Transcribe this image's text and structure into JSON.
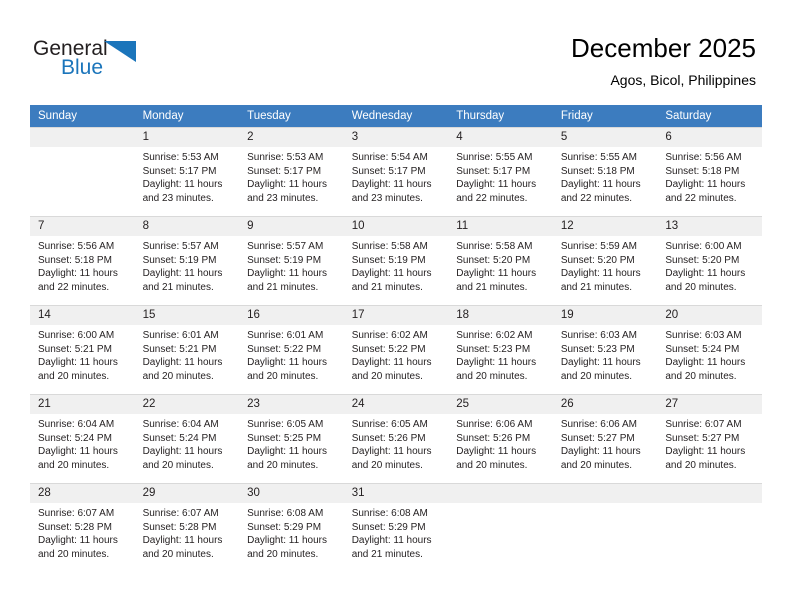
{
  "logo": {
    "word1": "General",
    "word2": "Blue",
    "icon": "triangle-logo-icon",
    "accent_color": "#1b75bb"
  },
  "header": {
    "title": "December 2025",
    "subtitle": "Agos, Bicol, Philippines"
  },
  "theme": {
    "header_row_bg": "#3c7cbf",
    "daynum_bg": "#f0f0f0",
    "grid_line": "#d9d9d9",
    "text": "#231f20"
  },
  "columns": [
    "Sunday",
    "Monday",
    "Tuesday",
    "Wednesday",
    "Thursday",
    "Friday",
    "Saturday"
  ],
  "weeks": [
    [
      {
        "day": "",
        "blank": true,
        "sunrise": "",
        "sunset": "",
        "daylight1": "",
        "daylight2": ""
      },
      {
        "day": "1",
        "sunrise": "Sunrise: 5:53 AM",
        "sunset": "Sunset: 5:17 PM",
        "daylight1": "Daylight: 11 hours",
        "daylight2": "and 23 minutes."
      },
      {
        "day": "2",
        "sunrise": "Sunrise: 5:53 AM",
        "sunset": "Sunset: 5:17 PM",
        "daylight1": "Daylight: 11 hours",
        "daylight2": "and 23 minutes."
      },
      {
        "day": "3",
        "sunrise": "Sunrise: 5:54 AM",
        "sunset": "Sunset: 5:17 PM",
        "daylight1": "Daylight: 11 hours",
        "daylight2": "and 23 minutes."
      },
      {
        "day": "4",
        "sunrise": "Sunrise: 5:55 AM",
        "sunset": "Sunset: 5:17 PM",
        "daylight1": "Daylight: 11 hours",
        "daylight2": "and 22 minutes."
      },
      {
        "day": "5",
        "sunrise": "Sunrise: 5:55 AM",
        "sunset": "Sunset: 5:18 PM",
        "daylight1": "Daylight: 11 hours",
        "daylight2": "and 22 minutes."
      },
      {
        "day": "6",
        "sunrise": "Sunrise: 5:56 AM",
        "sunset": "Sunset: 5:18 PM",
        "daylight1": "Daylight: 11 hours",
        "daylight2": "and 22 minutes."
      }
    ],
    [
      {
        "day": "7",
        "sunrise": "Sunrise: 5:56 AM",
        "sunset": "Sunset: 5:18 PM",
        "daylight1": "Daylight: 11 hours",
        "daylight2": "and 22 minutes."
      },
      {
        "day": "8",
        "sunrise": "Sunrise: 5:57 AM",
        "sunset": "Sunset: 5:19 PM",
        "daylight1": "Daylight: 11 hours",
        "daylight2": "and 21 minutes."
      },
      {
        "day": "9",
        "sunrise": "Sunrise: 5:57 AM",
        "sunset": "Sunset: 5:19 PM",
        "daylight1": "Daylight: 11 hours",
        "daylight2": "and 21 minutes."
      },
      {
        "day": "10",
        "sunrise": "Sunrise: 5:58 AM",
        "sunset": "Sunset: 5:19 PM",
        "daylight1": "Daylight: 11 hours",
        "daylight2": "and 21 minutes."
      },
      {
        "day": "11",
        "sunrise": "Sunrise: 5:58 AM",
        "sunset": "Sunset: 5:20 PM",
        "daylight1": "Daylight: 11 hours",
        "daylight2": "and 21 minutes."
      },
      {
        "day": "12",
        "sunrise": "Sunrise: 5:59 AM",
        "sunset": "Sunset: 5:20 PM",
        "daylight1": "Daylight: 11 hours",
        "daylight2": "and 21 minutes."
      },
      {
        "day": "13",
        "sunrise": "Sunrise: 6:00 AM",
        "sunset": "Sunset: 5:20 PM",
        "daylight1": "Daylight: 11 hours",
        "daylight2": "and 20 minutes."
      }
    ],
    [
      {
        "day": "14",
        "sunrise": "Sunrise: 6:00 AM",
        "sunset": "Sunset: 5:21 PM",
        "daylight1": "Daylight: 11 hours",
        "daylight2": "and 20 minutes."
      },
      {
        "day": "15",
        "sunrise": "Sunrise: 6:01 AM",
        "sunset": "Sunset: 5:21 PM",
        "daylight1": "Daylight: 11 hours",
        "daylight2": "and 20 minutes."
      },
      {
        "day": "16",
        "sunrise": "Sunrise: 6:01 AM",
        "sunset": "Sunset: 5:22 PM",
        "daylight1": "Daylight: 11 hours",
        "daylight2": "and 20 minutes."
      },
      {
        "day": "17",
        "sunrise": "Sunrise: 6:02 AM",
        "sunset": "Sunset: 5:22 PM",
        "daylight1": "Daylight: 11 hours",
        "daylight2": "and 20 minutes."
      },
      {
        "day": "18",
        "sunrise": "Sunrise: 6:02 AM",
        "sunset": "Sunset: 5:23 PM",
        "daylight1": "Daylight: 11 hours",
        "daylight2": "and 20 minutes."
      },
      {
        "day": "19",
        "sunrise": "Sunrise: 6:03 AM",
        "sunset": "Sunset: 5:23 PM",
        "daylight1": "Daylight: 11 hours",
        "daylight2": "and 20 minutes."
      },
      {
        "day": "20",
        "sunrise": "Sunrise: 6:03 AM",
        "sunset": "Sunset: 5:24 PM",
        "daylight1": "Daylight: 11 hours",
        "daylight2": "and 20 minutes."
      }
    ],
    [
      {
        "day": "21",
        "sunrise": "Sunrise: 6:04 AM",
        "sunset": "Sunset: 5:24 PM",
        "daylight1": "Daylight: 11 hours",
        "daylight2": "and 20 minutes."
      },
      {
        "day": "22",
        "sunrise": "Sunrise: 6:04 AM",
        "sunset": "Sunset: 5:24 PM",
        "daylight1": "Daylight: 11 hours",
        "daylight2": "and 20 minutes."
      },
      {
        "day": "23",
        "sunrise": "Sunrise: 6:05 AM",
        "sunset": "Sunset: 5:25 PM",
        "daylight1": "Daylight: 11 hours",
        "daylight2": "and 20 minutes."
      },
      {
        "day": "24",
        "sunrise": "Sunrise: 6:05 AM",
        "sunset": "Sunset: 5:26 PM",
        "daylight1": "Daylight: 11 hours",
        "daylight2": "and 20 minutes."
      },
      {
        "day": "25",
        "sunrise": "Sunrise: 6:06 AM",
        "sunset": "Sunset: 5:26 PM",
        "daylight1": "Daylight: 11 hours",
        "daylight2": "and 20 minutes."
      },
      {
        "day": "26",
        "sunrise": "Sunrise: 6:06 AM",
        "sunset": "Sunset: 5:27 PM",
        "daylight1": "Daylight: 11 hours",
        "daylight2": "and 20 minutes."
      },
      {
        "day": "27",
        "sunrise": "Sunrise: 6:07 AM",
        "sunset": "Sunset: 5:27 PM",
        "daylight1": "Daylight: 11 hours",
        "daylight2": "and 20 minutes."
      }
    ],
    [
      {
        "day": "28",
        "sunrise": "Sunrise: 6:07 AM",
        "sunset": "Sunset: 5:28 PM",
        "daylight1": "Daylight: 11 hours",
        "daylight2": "and 20 minutes."
      },
      {
        "day": "29",
        "sunrise": "Sunrise: 6:07 AM",
        "sunset": "Sunset: 5:28 PM",
        "daylight1": "Daylight: 11 hours",
        "daylight2": "and 20 minutes."
      },
      {
        "day": "30",
        "sunrise": "Sunrise: 6:08 AM",
        "sunset": "Sunset: 5:29 PM",
        "daylight1": "Daylight: 11 hours",
        "daylight2": "and 20 minutes."
      },
      {
        "day": "31",
        "sunrise": "Sunrise: 6:08 AM",
        "sunset": "Sunset: 5:29 PM",
        "daylight1": "Daylight: 11 hours",
        "daylight2": "and 21 minutes."
      },
      {
        "day": "",
        "blank": true,
        "sunrise": "",
        "sunset": "",
        "daylight1": "",
        "daylight2": ""
      },
      {
        "day": "",
        "blank": true,
        "sunrise": "",
        "sunset": "",
        "daylight1": "",
        "daylight2": ""
      },
      {
        "day": "",
        "blank": true,
        "sunrise": "",
        "sunset": "",
        "daylight1": "",
        "daylight2": ""
      }
    ]
  ]
}
